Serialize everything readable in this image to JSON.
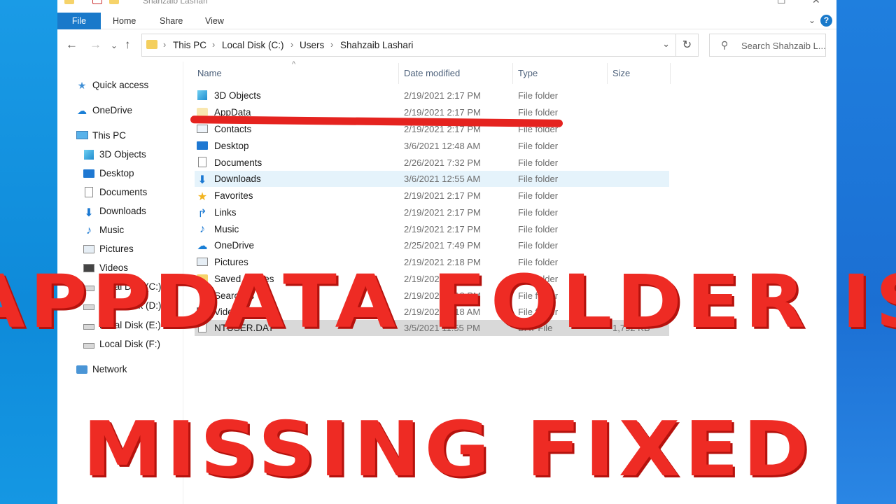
{
  "window": {
    "title": "Shahzaib Lashari"
  },
  "ribbon": {
    "tabs": [
      "File",
      "Home",
      "Share",
      "View"
    ],
    "help": "?"
  },
  "navbar": {
    "breadcrumb": [
      "This PC",
      "Local Disk (C:)",
      "Users",
      "Shahzaib Lashari"
    ],
    "search_placeholder": "Search Shahzaib L..."
  },
  "sidebar": {
    "items": [
      {
        "label": "Quick access",
        "icon": "star-icon"
      },
      {
        "label": "OneDrive",
        "icon": "cloud-icon"
      },
      {
        "label": "This PC",
        "icon": "computer-icon"
      },
      {
        "label": "3D Objects",
        "icon": "cube-icon"
      },
      {
        "label": "Desktop",
        "icon": "desktop-icon"
      },
      {
        "label": "Documents",
        "icon": "document-icon"
      },
      {
        "label": "Downloads",
        "icon": "download-icon"
      },
      {
        "label": "Music",
        "icon": "music-icon"
      },
      {
        "label": "Pictures",
        "icon": "pictures-icon"
      },
      {
        "label": "Videos",
        "icon": "video-icon"
      },
      {
        "label": "Local Disk (C:)",
        "icon": "drive-icon"
      },
      {
        "label": "Local Disk (D:)",
        "icon": "drive-icon"
      },
      {
        "label": "Local Disk (E:)",
        "icon": "drive-icon"
      },
      {
        "label": "Local Disk (F:)",
        "icon": "drive-icon"
      },
      {
        "label": "Network",
        "icon": "network-icon"
      }
    ]
  },
  "columns": {
    "name": "Name",
    "date": "Date modified",
    "type": "Type",
    "size": "Size"
  },
  "files": [
    {
      "name": "3D Objects",
      "date": "2/19/2021 2:17 PM",
      "type": "File folder",
      "size": "",
      "icon": "cube-icon"
    },
    {
      "name": "AppData",
      "date": "2/19/2021 2:17 PM",
      "type": "File folder",
      "size": "",
      "icon": "folder-icon"
    },
    {
      "name": "Contacts",
      "date": "2/19/2021 2:17 PM",
      "type": "File folder",
      "size": "",
      "icon": "contacts-icon"
    },
    {
      "name": "Desktop",
      "date": "3/6/2021 12:48 AM",
      "type": "File folder",
      "size": "",
      "icon": "desktop-icon"
    },
    {
      "name": "Documents",
      "date": "2/26/2021 7:32 PM",
      "type": "File folder",
      "size": "",
      "icon": "document-icon"
    },
    {
      "name": "Downloads",
      "date": "3/6/2021 12:55 AM",
      "type": "File folder",
      "size": "",
      "icon": "download-icon"
    },
    {
      "name": "Favorites",
      "date": "2/19/2021 2:17 PM",
      "type": "File folder",
      "size": "",
      "icon": "star-icon"
    },
    {
      "name": "Links",
      "date": "2/19/2021 2:17 PM",
      "type": "File folder",
      "size": "",
      "icon": "link-icon"
    },
    {
      "name": "Music",
      "date": "2/19/2021 2:17 PM",
      "type": "File folder",
      "size": "",
      "icon": "music-icon"
    },
    {
      "name": "OneDrive",
      "date": "2/25/2021 7:49 PM",
      "type": "File folder",
      "size": "",
      "icon": "cloud-icon"
    },
    {
      "name": "Pictures",
      "date": "2/19/2021 2:18 PM",
      "type": "File folder",
      "size": "",
      "icon": "pictures-icon"
    },
    {
      "name": "Saved Games",
      "date": "2/19/2021 2:18 PM",
      "type": "File folder",
      "size": "",
      "icon": "folder-icon"
    },
    {
      "name": "Searches",
      "date": "2/19/2021 2:18 PM",
      "type": "File folder",
      "size": "",
      "icon": "search-icon"
    },
    {
      "name": "Videos",
      "date": "2/19/2021 2:18 AM",
      "type": "File folder",
      "size": "",
      "icon": "video-icon"
    },
    {
      "name": "NTUSER.DAT",
      "date": "3/5/2021 11:55 PM",
      "type": "DAT File",
      "size": "1,792 KB",
      "icon": "file-icon"
    }
  ],
  "overlay": {
    "line1": "APPDATA FOLDER IS",
    "line2": "MISSING FIXED"
  },
  "colors": {
    "accent": "#1979ca",
    "overlay_red": "#ee2b24",
    "selection": "#e5f3fb"
  }
}
